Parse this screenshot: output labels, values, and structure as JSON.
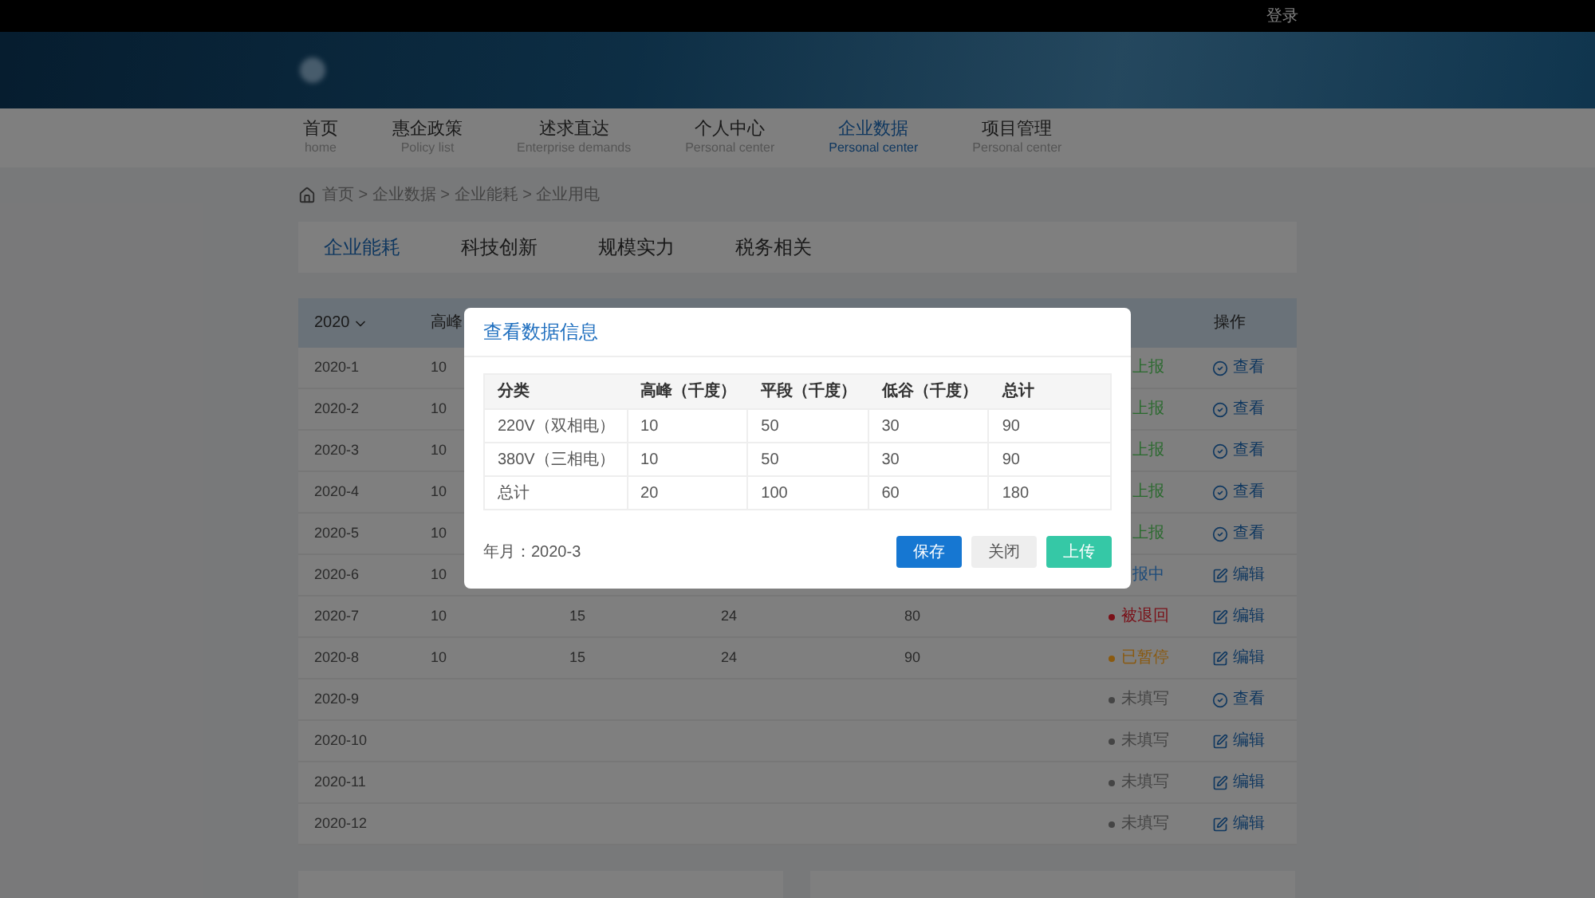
{
  "top_bar": {
    "login": "登录"
  },
  "nav": [
    {
      "label": "首页",
      "sub": "home",
      "selected": false
    },
    {
      "label": "惠企政策",
      "sub": "Policy list",
      "selected": false
    },
    {
      "label": "述求直达",
      "sub": "Enterprise demands",
      "selected": false
    },
    {
      "label": "个人中心",
      "sub": "Personal center",
      "selected": false
    },
    {
      "label": "企业数据",
      "sub": "Personal center",
      "selected": true
    },
    {
      "label": "项目管理",
      "sub": "Personal center",
      "selected": false
    }
  ],
  "breadcrumb": "首页 > 企业数据 > 企业能耗 > 企业用电",
  "tabs": [
    {
      "label": "企业能耗",
      "selected": true
    },
    {
      "label": "科技创新",
      "selected": false
    },
    {
      "label": "规模实力",
      "selected": false
    },
    {
      "label": "税务相关",
      "selected": false
    }
  ],
  "table": {
    "year": "2020",
    "columns": [
      "高峰",
      "操作"
    ],
    "rows": [
      {
        "month": "2020-1",
        "cells": [
          "10"
        ],
        "status": {
          "kind": "covered",
          "text": "上报",
          "color": "#2a6a2e"
        },
        "action": {
          "kind": "view",
          "label": "查看"
        }
      },
      {
        "month": "2020-2",
        "cells": [
          "10"
        ],
        "status": {
          "kind": "covered",
          "text": "上报",
          "color": "#2a6a2e"
        },
        "action": {
          "kind": "view",
          "label": "查看"
        }
      },
      {
        "month": "2020-3",
        "cells": [
          "10"
        ],
        "status": {
          "kind": "covered",
          "text": "上报",
          "color": "#2a6a2e"
        },
        "action": {
          "kind": "view",
          "label": "查看"
        }
      },
      {
        "month": "2020-4",
        "cells": [
          "10"
        ],
        "status": {
          "kind": "covered",
          "text": "上报",
          "color": "#2a6a2e"
        },
        "action": {
          "kind": "view",
          "label": "查看"
        }
      },
      {
        "month": "2020-5",
        "cells": [
          "10"
        ],
        "status": {
          "kind": "covered",
          "text": "上报",
          "color": "#2a6a2e"
        },
        "action": {
          "kind": "view",
          "label": "查看"
        }
      },
      {
        "month": "2020-6",
        "cells": [
          "10"
        ],
        "status": {
          "kind": "covered",
          "text": "报中",
          "color": "#1a4a7a"
        },
        "action": {
          "kind": "edit",
          "label": "编辑"
        }
      },
      {
        "month": "2020-7",
        "cells": [
          "10",
          "15",
          "24",
          "80"
        ],
        "status": {
          "kind": "dot",
          "text": "被退回",
          "color": "#7a1018"
        },
        "action": {
          "kind": "edit",
          "label": "编辑"
        }
      },
      {
        "month": "2020-8",
        "cells": [
          "10",
          "15",
          "24",
          "90"
        ],
        "status": {
          "kind": "dot",
          "text": "已暂停",
          "color": "#8a5a10"
        },
        "action": {
          "kind": "edit",
          "label": "编辑"
        }
      },
      {
        "month": "2020-9",
        "cells": [],
        "status": {
          "kind": "dot",
          "text": "未填写",
          "color": "#454545"
        },
        "action": {
          "kind": "view",
          "label": "查看"
        }
      },
      {
        "month": "2020-10",
        "cells": [],
        "status": {
          "kind": "dot",
          "text": "未填写",
          "color": "#454545"
        },
        "action": {
          "kind": "edit",
          "label": "编辑"
        }
      },
      {
        "month": "2020-11",
        "cells": [],
        "status": {
          "kind": "dot",
          "text": "未填写",
          "color": "#454545"
        },
        "action": {
          "kind": "edit",
          "label": "编辑"
        }
      },
      {
        "month": "2020-12",
        "cells": [],
        "status": {
          "kind": "dot",
          "text": "未填写",
          "color": "#454545"
        },
        "action": {
          "kind": "edit",
          "label": "编辑"
        }
      }
    ]
  },
  "dialog": {
    "title": "查看数据信息",
    "columns": [
      "分类",
      "高峰（千度）",
      "平段（千度）",
      "低谷（千度）",
      "总计"
    ],
    "rows": [
      [
        "220V（双相电）",
        "10",
        "50",
        "30",
        "90"
      ],
      [
        "380V（三相电）",
        "10",
        "50",
        "30",
        "90"
      ],
      [
        "总计",
        "20",
        "100",
        "60",
        "180"
      ]
    ],
    "period": "年月：2020-3",
    "buttons": [
      {
        "kind": "primary",
        "label": "保存"
      },
      {
        "kind": "default",
        "label": "关闭"
      },
      {
        "kind": "success",
        "label": "上传"
      }
    ]
  }
}
